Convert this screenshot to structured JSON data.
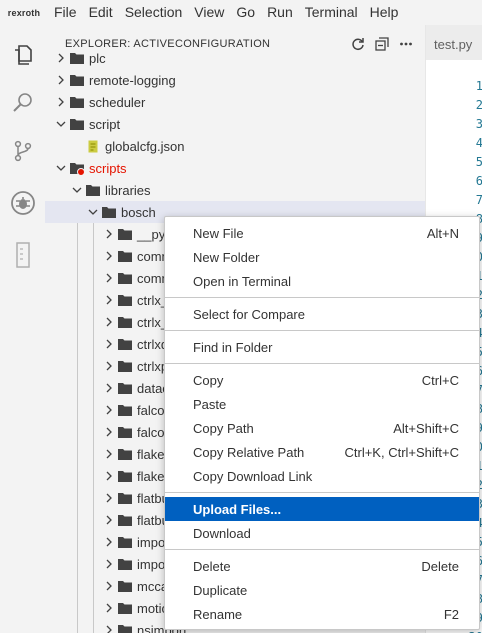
{
  "menubar": {
    "logo": "rexroth",
    "items": [
      "File",
      "Edit",
      "Selection",
      "View",
      "Go",
      "Run",
      "Terminal",
      "Help"
    ]
  },
  "sidebar": {
    "title": "EXPLORER: ACTIVECONFIGURATION"
  },
  "tree": [
    {
      "label": "plc",
      "indent": 0,
      "type": "folder",
      "expanded": false
    },
    {
      "label": "remote-logging",
      "indent": 0,
      "type": "folder",
      "expanded": false
    },
    {
      "label": "scheduler",
      "indent": 0,
      "type": "folder",
      "expanded": false
    },
    {
      "label": "script",
      "indent": 0,
      "type": "folder",
      "expanded": true
    },
    {
      "label": "globalcfg.json",
      "indent": 1,
      "type": "json"
    },
    {
      "label": "scripts",
      "indent": 0,
      "type": "folder",
      "expanded": true,
      "error": true
    },
    {
      "label": "libraries",
      "indent": 1,
      "type": "folder",
      "expanded": true
    },
    {
      "label": "bosch",
      "indent": 2,
      "type": "folder",
      "expanded": true,
      "selected": true
    },
    {
      "label": "__pycache__",
      "indent": 3,
      "type": "folder",
      "expanded": false
    },
    {
      "label": "comm",
      "indent": 3,
      "type": "folder",
      "expanded": false
    },
    {
      "label": "common",
      "indent": 3,
      "type": "folder",
      "expanded": false
    },
    {
      "label": "ctrlx_datalayer",
      "indent": 3,
      "type": "folder",
      "expanded": false
    },
    {
      "label": "ctrlx_fbs-1",
      "indent": 3,
      "type": "folder",
      "expanded": false
    },
    {
      "label": "ctrlxdatalayer",
      "indent": 3,
      "type": "folder",
      "expanded": false
    },
    {
      "label": "ctrlxpy",
      "indent": 3,
      "type": "folder",
      "expanded": false
    },
    {
      "label": "dataclasses",
      "indent": 3,
      "type": "folder",
      "expanded": false
    },
    {
      "label": "falcon",
      "indent": 3,
      "type": "folder",
      "expanded": false
    },
    {
      "label": "falcon-3.1",
      "indent": 3,
      "type": "folder",
      "expanded": false
    },
    {
      "label": "flake8",
      "indent": 3,
      "type": "folder",
      "expanded": false
    },
    {
      "label": "flake8-5.0",
      "indent": 3,
      "type": "folder",
      "expanded": false
    },
    {
      "label": "flatbuffers",
      "indent": 3,
      "type": "folder",
      "expanded": false
    },
    {
      "label": "flatbuffers",
      "indent": 3,
      "type": "folder",
      "expanded": false
    },
    {
      "label": "importlib_",
      "indent": 3,
      "type": "folder",
      "expanded": false
    },
    {
      "label": "importlib_",
      "indent": 3,
      "type": "folder",
      "expanded": false
    },
    {
      "label": "mccabe-0",
      "indent": 3,
      "type": "folder",
      "expanded": false
    },
    {
      "label": "motion",
      "indent": 3,
      "type": "folder",
      "expanded": false
    },
    {
      "label": "nsimport",
      "indent": 3,
      "type": "folder",
      "expanded": false
    }
  ],
  "editor": {
    "tab": "test.py",
    "line_numbers": [
      "1",
      "2",
      "3",
      "4",
      "5",
      "6",
      "7",
      "8",
      "9",
      "10",
      "11",
      "12",
      "13",
      "14",
      "15",
      "16",
      "17",
      "18",
      "19",
      "20",
      "21",
      "22",
      "23",
      "24",
      "25",
      "26",
      "27",
      "28",
      "29",
      "30"
    ]
  },
  "context_menu": {
    "groups": [
      [
        {
          "label": "New File",
          "shortcut": "Alt+N"
        },
        {
          "label": "New Folder",
          "shortcut": ""
        },
        {
          "label": "Open in Terminal",
          "shortcut": ""
        }
      ],
      [
        {
          "label": "Select for Compare",
          "shortcut": ""
        }
      ],
      [
        {
          "label": "Find in Folder",
          "shortcut": ""
        }
      ],
      [
        {
          "label": "Copy",
          "shortcut": "Ctrl+C"
        },
        {
          "label": "Paste",
          "shortcut": ""
        },
        {
          "label": "Copy Path",
          "shortcut": "Alt+Shift+C"
        },
        {
          "label": "Copy Relative Path",
          "shortcut": "Ctrl+K, Ctrl+Shift+C"
        },
        {
          "label": "Copy Download Link",
          "shortcut": ""
        }
      ],
      [
        {
          "label": "Upload Files...",
          "shortcut": "",
          "active": true
        },
        {
          "label": "Download",
          "shortcut": ""
        }
      ],
      [
        {
          "label": "Delete",
          "shortcut": "Delete"
        },
        {
          "label": "Duplicate",
          "shortcut": ""
        },
        {
          "label": "Rename",
          "shortcut": "F2"
        }
      ]
    ]
  },
  "colors": {
    "accent": "#0060c0",
    "error": "#e51400",
    "folder": "#424242",
    "json": "#cbcb41"
  }
}
